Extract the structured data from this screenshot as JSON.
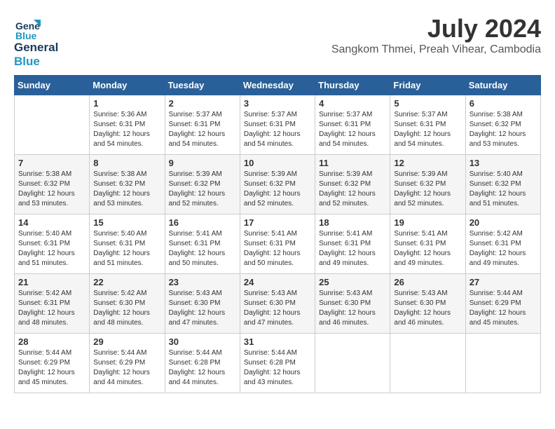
{
  "logo": {
    "line1": "General",
    "line2": "Blue"
  },
  "title": "July 2024",
  "subtitle": "Sangkom Thmei, Preah Vihear, Cambodia",
  "days_of_week": [
    "Sunday",
    "Monday",
    "Tuesday",
    "Wednesday",
    "Thursday",
    "Friday",
    "Saturday"
  ],
  "weeks": [
    [
      {
        "day": "",
        "info": ""
      },
      {
        "day": "1",
        "info": "Sunrise: 5:36 AM\nSunset: 6:31 PM\nDaylight: 12 hours\nand 54 minutes."
      },
      {
        "day": "2",
        "info": "Sunrise: 5:37 AM\nSunset: 6:31 PM\nDaylight: 12 hours\nand 54 minutes."
      },
      {
        "day": "3",
        "info": "Sunrise: 5:37 AM\nSunset: 6:31 PM\nDaylight: 12 hours\nand 54 minutes."
      },
      {
        "day": "4",
        "info": "Sunrise: 5:37 AM\nSunset: 6:31 PM\nDaylight: 12 hours\nand 54 minutes."
      },
      {
        "day": "5",
        "info": "Sunrise: 5:37 AM\nSunset: 6:31 PM\nDaylight: 12 hours\nand 54 minutes."
      },
      {
        "day": "6",
        "info": "Sunrise: 5:38 AM\nSunset: 6:32 PM\nDaylight: 12 hours\nand 53 minutes."
      }
    ],
    [
      {
        "day": "7",
        "info": "Sunrise: 5:38 AM\nSunset: 6:32 PM\nDaylight: 12 hours\nand 53 minutes."
      },
      {
        "day": "8",
        "info": "Sunrise: 5:38 AM\nSunset: 6:32 PM\nDaylight: 12 hours\nand 53 minutes."
      },
      {
        "day": "9",
        "info": "Sunrise: 5:39 AM\nSunset: 6:32 PM\nDaylight: 12 hours\nand 52 minutes."
      },
      {
        "day": "10",
        "info": "Sunrise: 5:39 AM\nSunset: 6:32 PM\nDaylight: 12 hours\nand 52 minutes."
      },
      {
        "day": "11",
        "info": "Sunrise: 5:39 AM\nSunset: 6:32 PM\nDaylight: 12 hours\nand 52 minutes."
      },
      {
        "day": "12",
        "info": "Sunrise: 5:39 AM\nSunset: 6:32 PM\nDaylight: 12 hours\nand 52 minutes."
      },
      {
        "day": "13",
        "info": "Sunrise: 5:40 AM\nSunset: 6:32 PM\nDaylight: 12 hours\nand 51 minutes."
      }
    ],
    [
      {
        "day": "14",
        "info": "Sunrise: 5:40 AM\nSunset: 6:31 PM\nDaylight: 12 hours\nand 51 minutes."
      },
      {
        "day": "15",
        "info": "Sunrise: 5:40 AM\nSunset: 6:31 PM\nDaylight: 12 hours\nand 51 minutes."
      },
      {
        "day": "16",
        "info": "Sunrise: 5:41 AM\nSunset: 6:31 PM\nDaylight: 12 hours\nand 50 minutes."
      },
      {
        "day": "17",
        "info": "Sunrise: 5:41 AM\nSunset: 6:31 PM\nDaylight: 12 hours\nand 50 minutes."
      },
      {
        "day": "18",
        "info": "Sunrise: 5:41 AM\nSunset: 6:31 PM\nDaylight: 12 hours\nand 49 minutes."
      },
      {
        "day": "19",
        "info": "Sunrise: 5:41 AM\nSunset: 6:31 PM\nDaylight: 12 hours\nand 49 minutes."
      },
      {
        "day": "20",
        "info": "Sunrise: 5:42 AM\nSunset: 6:31 PM\nDaylight: 12 hours\nand 49 minutes."
      }
    ],
    [
      {
        "day": "21",
        "info": "Sunrise: 5:42 AM\nSunset: 6:31 PM\nDaylight: 12 hours\nand 48 minutes."
      },
      {
        "day": "22",
        "info": "Sunrise: 5:42 AM\nSunset: 6:30 PM\nDaylight: 12 hours\nand 48 minutes."
      },
      {
        "day": "23",
        "info": "Sunrise: 5:43 AM\nSunset: 6:30 PM\nDaylight: 12 hours\nand 47 minutes."
      },
      {
        "day": "24",
        "info": "Sunrise: 5:43 AM\nSunset: 6:30 PM\nDaylight: 12 hours\nand 47 minutes."
      },
      {
        "day": "25",
        "info": "Sunrise: 5:43 AM\nSunset: 6:30 PM\nDaylight: 12 hours\nand 46 minutes."
      },
      {
        "day": "26",
        "info": "Sunrise: 5:43 AM\nSunset: 6:30 PM\nDaylight: 12 hours\nand 46 minutes."
      },
      {
        "day": "27",
        "info": "Sunrise: 5:44 AM\nSunset: 6:29 PM\nDaylight: 12 hours\nand 45 minutes."
      }
    ],
    [
      {
        "day": "28",
        "info": "Sunrise: 5:44 AM\nSunset: 6:29 PM\nDaylight: 12 hours\nand 45 minutes."
      },
      {
        "day": "29",
        "info": "Sunrise: 5:44 AM\nSunset: 6:29 PM\nDaylight: 12 hours\nand 44 minutes."
      },
      {
        "day": "30",
        "info": "Sunrise: 5:44 AM\nSunset: 6:28 PM\nDaylight: 12 hours\nand 44 minutes."
      },
      {
        "day": "31",
        "info": "Sunrise: 5:44 AM\nSunset: 6:28 PM\nDaylight: 12 hours\nand 43 minutes."
      },
      {
        "day": "",
        "info": ""
      },
      {
        "day": "",
        "info": ""
      },
      {
        "day": "",
        "info": ""
      }
    ]
  ]
}
